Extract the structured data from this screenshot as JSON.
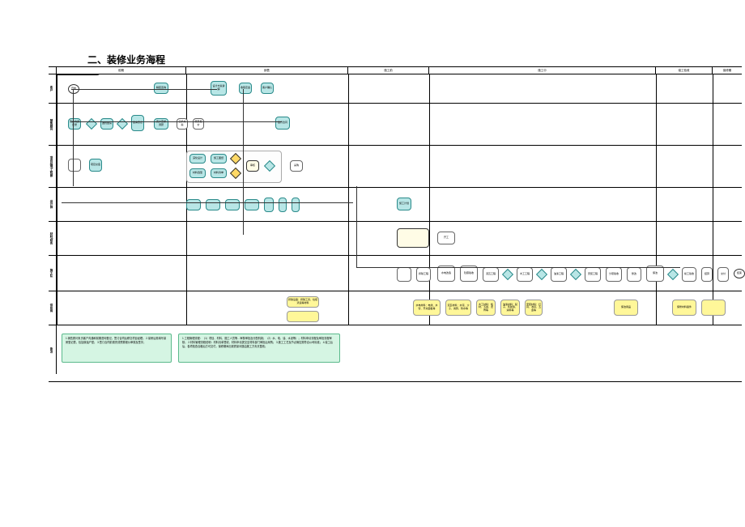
{
  "title": "二、装修业务海程",
  "header_badge": "精装置家业务流程图",
  "columns": {
    "c1": "前期",
    "c2": "销售",
    "c3": "施工前",
    "c4": "施工中",
    "c5": "竣工验收",
    "c6": "保修期"
  },
  "lanes": {
    "l1": "客户",
    "l2": "销售顾问",
    "l3": "项目经理/工程部",
    "l4": "设计师",
    "l5": "材料/财务",
    "l6": "施工队",
    "l7": "供应商"
  },
  "nodes": {
    "n1": "开始",
    "n2": "精装咨询",
    "n3": "客户沟通记录",
    "n4": "邀约量房",
    "n5": "量房登记",
    "n6": "客户需求调研",
    "n7": "初步方案",
    "n8": "设计方案讲解",
    "n9": "预算报价",
    "n10": "签订合同",
    "n11": "收取定金",
    "n12": "客户确认",
    "n13": "深化设计",
    "n14": "施工图纸",
    "n15": "材料选型",
    "n16": "材料清单",
    "n17": "审核",
    "n18": "采购",
    "n19": "项目交底",
    "n20": "施工计划",
    "n21": "开工",
    "n22": "拆除工程",
    "n23": "水电改造",
    "n24": "隐蔽验收",
    "n25": "泥瓦工程",
    "n26": "木工工程",
    "n27": "油漆工程",
    "n28": "安装工程",
    "n29": "分项验收",
    "n30": "整改",
    "n31": "保洁",
    "n32": "竣工验收",
    "n33": "结算",
    "n34": "交付",
    "n35": "回访",
    "n36": "保修",
    "n37": "结束",
    "y1": "拆除设备：拆除工具、垃圾清运等材料",
    "y2": "水电材料：电线、水管、开关面板等",
    "y3": "泥瓦材料：水泥、沙子、瓷砖、防水等",
    "y4": "木工材料：板材、五金、龙骨等",
    "y5": "油漆材料：腻子、乳胶漆、涂料等",
    "y6": "安装材料：灯具、洁具、五金等",
    "y7": "保洁用品",
    "y8": "保修材料备件"
  },
  "notes": {
    "note1": "1.销售顾问负责客户沟通和前期咨询登记，签订合同后移交项目经理；\n2.量房后需填写量房登记表，包括原始户型；\n3.签订合同前需完成预算报价审核及签字；",
    "note2": "1.工程管理流程：（1）项目、材料、施工人员等…审核审批及分配机制；（2）水、电、油、水泥等）；材料申请流程及审批流程审核；\n2.材料管理流程说明：材料清单签收、材料申请提交至材料部门审批后采购；\n3.施工工艺及节点管控需符合公司标准；\n4.竣工后后，各项检查合格后方可交付，保修期间出现质量问题由施工方负责整改；"
  }
}
